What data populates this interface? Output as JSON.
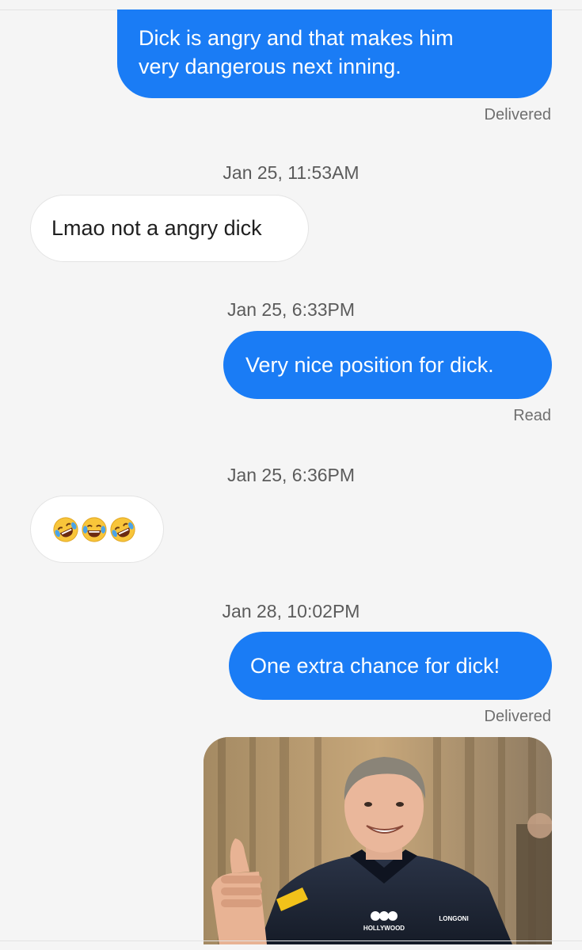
{
  "messages": {
    "m1": {
      "line1": "Dick is angry and that makes him",
      "line2": "very dangerous next inning.",
      "status": "Delivered"
    },
    "t1": "Jan 25, 11:53AM",
    "m2": {
      "text": "Lmao not a angry dick"
    },
    "t2": "Jan 25, 6:33PM",
    "m3": {
      "text": "Very nice position for dick.",
      "status": "Read"
    },
    "t3": "Jan 25, 6:36PM",
    "m4": {
      "emojis": [
        "rolling-on-floor-laughing-emoji",
        "tears-of-joy-emoji",
        "rolling-on-floor-laughing-emoji"
      ]
    },
    "t4": "Jan 28, 10:02PM",
    "m5": {
      "text": "One extra chance for dick!",
      "status": "Delivered"
    },
    "m6": {
      "image": "photo of smiling man giving thumbs up",
      "shirt_logo_left": "HOLLYWOOD",
      "shirt_logo_right": "LONGONI"
    }
  },
  "colors": {
    "outgoing_bubble": "#1a7cf5",
    "incoming_bubble": "#ffffff",
    "background": "#f5f5f5"
  }
}
